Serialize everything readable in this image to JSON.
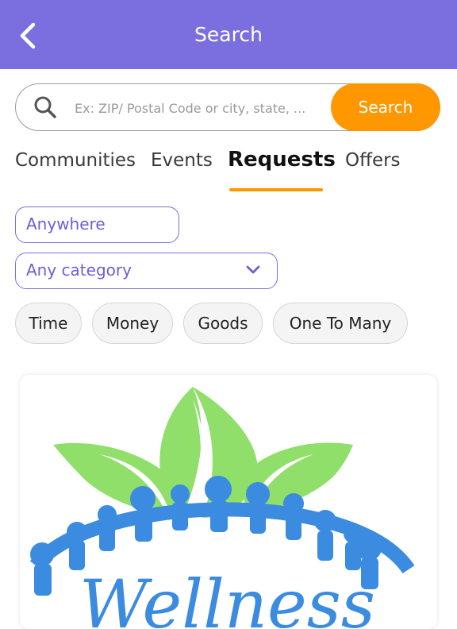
{
  "header": {
    "title": "Search",
    "back_icon": "chevron-left-icon",
    "background": "#7b6fe0"
  },
  "search": {
    "placeholder": "Ex: ZIP/ Postal Code or city, state, ...",
    "button_label": "Search",
    "icon": "search-icon",
    "accent": "#ff9800"
  },
  "tabs": [
    {
      "label": "Communities",
      "active": false
    },
    {
      "label": "Events",
      "active": false
    },
    {
      "label": "Requests",
      "active": true
    },
    {
      "label": "Offers",
      "active": false
    }
  ],
  "filters": {
    "location": "Anywhere",
    "category": "Any category"
  },
  "chips": [
    {
      "label": "Time"
    },
    {
      "label": "Money"
    },
    {
      "label": "Goods"
    },
    {
      "label": "One To Many"
    }
  ],
  "result_card": {
    "logo_text": "Wellness",
    "logo_colors": {
      "leaves": "#8fdf6a",
      "people": "#3b8be0"
    }
  }
}
